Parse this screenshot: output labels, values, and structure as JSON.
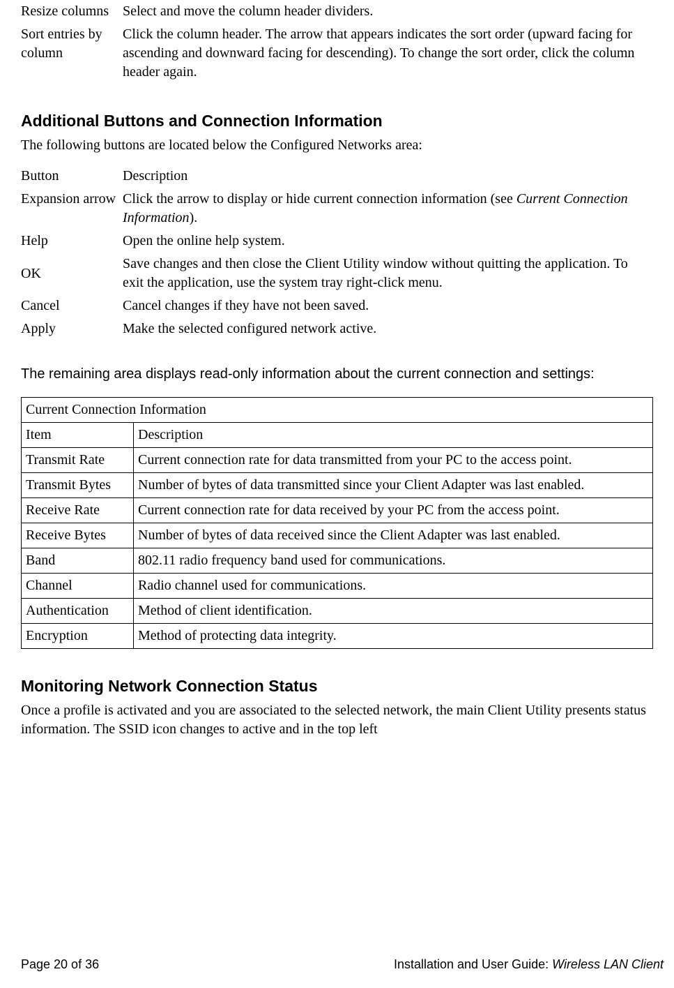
{
  "table1": {
    "rows": [
      {
        "term": "Resize columns",
        "desc": "Select and move the column header dividers."
      },
      {
        "term": "Sort entries by column",
        "desc": "Click the column header. The arrow that appears indicates the sort order (upward facing for ascending and downward facing for descending). To change the sort order, click the column header again."
      }
    ]
  },
  "section_buttons": {
    "heading": "Additional Buttons and Connection Information",
    "intro": "The following buttons are located below the Configured Networks area:",
    "header_term": "Button",
    "header_desc": "Description",
    "rows": [
      {
        "term": "Expansion arrow",
        "desc_pre": "Click the arrow to display or hide current connection information (see ",
        "desc_em": "Current Connection Information",
        "desc_post": ")."
      },
      {
        "term": "Help",
        "desc": "Open the online help system."
      },
      {
        "term": "OK",
        "desc": "Save changes and then close the Client Utility window without quitting the application. To exit the application, use the system tray right-click menu."
      },
      {
        "term": "Cancel",
        "desc": "Cancel changes if they have not been saved."
      },
      {
        "term": "Apply",
        "desc": "Make the selected configured network active."
      }
    ]
  },
  "remaining_text": "The remaining area displays read-only information about the current connection and settings:",
  "cci": {
    "caption": "Current Connection Information",
    "header_item": "Item",
    "header_desc": "Description",
    "rows": [
      {
        "item": "Transmit Rate",
        "desc": "Current connection rate for data transmitted from your PC to the access point."
      },
      {
        "item": "Transmit Bytes",
        "desc": "Number of bytes of data transmitted since your Client Adapter was last enabled."
      },
      {
        "item": "Receive Rate",
        "desc": "Current connection rate for data received by your PC from the access point."
      },
      {
        "item": "Receive Bytes",
        "desc": "Number of bytes of data received since the Client Adapter was last enabled."
      },
      {
        "item": "Band",
        "desc": "802.11 radio frequency band used for communications."
      },
      {
        "item": "Channel",
        "desc": "Radio channel used for communications."
      },
      {
        "item": "Authentication",
        "desc": "Method of client identification."
      },
      {
        "item": "Encryption",
        "desc": "Method of protecting data integrity."
      }
    ]
  },
  "section_monitor": {
    "heading": "Monitoring Network Connection Status",
    "para": "Once a profile is activated and you are associated to the selected network, the main Client Utility presents status information. The SSID icon changes to active and in the top left"
  },
  "footer": {
    "left": "Page 20 of 36",
    "right_pre": "Installation and User Guide: ",
    "right_em": "Wireless LAN Client"
  }
}
